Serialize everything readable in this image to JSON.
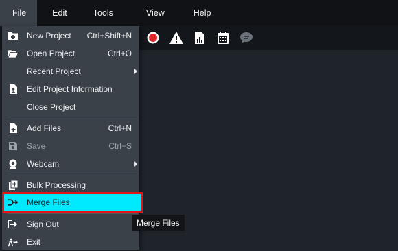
{
  "menubar": {
    "items": [
      {
        "label": "File"
      },
      {
        "label": "Edit"
      },
      {
        "label": "Tools"
      },
      {
        "label": "View"
      },
      {
        "label": "Help"
      }
    ]
  },
  "toolbar": {
    "icons": [
      "record-icon",
      "warning-icon",
      "report-icon",
      "calendar-icon",
      "chat-icon"
    ],
    "colors": {
      "record": "#e0262b",
      "chat": "#6b7178"
    }
  },
  "file_menu": {
    "new_project": {
      "label": "New Project",
      "shortcut": "Ctrl+Shift+N"
    },
    "open_project": {
      "label": "Open Project",
      "shortcut": "Ctrl+O"
    },
    "recent_project": {
      "label": "Recent Project"
    },
    "edit_project_info": {
      "label": "Edit Project Information"
    },
    "close_project": {
      "label": "Close Project"
    },
    "add_files": {
      "label": "Add Files",
      "shortcut": "Ctrl+N"
    },
    "save": {
      "label": "Save",
      "shortcut": "Ctrl+S"
    },
    "webcam": {
      "label": "Webcam"
    },
    "bulk_processing": {
      "label": "Bulk Processing"
    },
    "merge_files": {
      "label": "Merge Files"
    },
    "sign_out": {
      "label": "Sign Out"
    },
    "exit": {
      "label": "Exit"
    }
  },
  "tooltip": {
    "text": "Merge Files"
  },
  "colors": {
    "highlight": "#00eaff",
    "highlight_border": "#e3131b",
    "menu_bg": "#3a4149"
  }
}
